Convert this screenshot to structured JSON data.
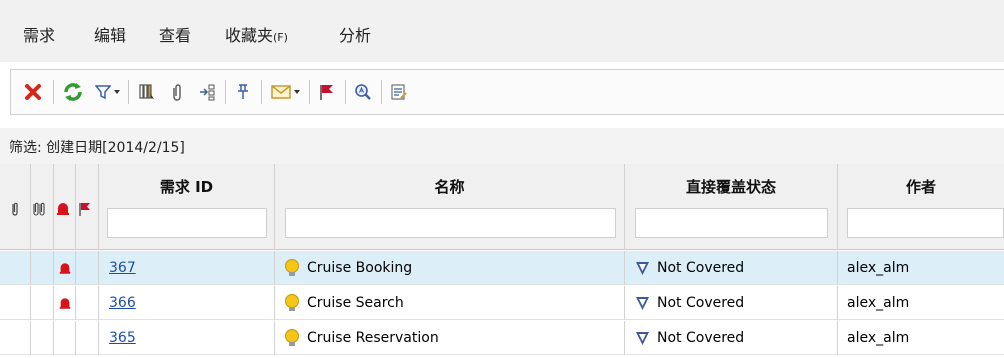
{
  "menu": {
    "items": [
      {
        "label": "需求",
        "hotkey": ""
      },
      {
        "label": "编辑",
        "hotkey": ""
      },
      {
        "label": "查看",
        "hotkey": ""
      },
      {
        "label": "收藏夹",
        "hotkey": "(F)"
      },
      {
        "label": "分析",
        "hotkey": ""
      }
    ]
  },
  "toolbar": {
    "buttons": [
      {
        "icon": "delete-icon",
        "color": "#d9261c"
      },
      {
        "icon": "refresh-icon",
        "color": "#2e9c2e"
      },
      {
        "icon": "filter-icon",
        "color": "#3b5fa8"
      },
      {
        "icon": "select-columns-icon",
        "color": "#5a5a5a"
      },
      {
        "icon": "attachment-icon",
        "color": "#5a5a5a"
      },
      {
        "icon": "convert-tree-icon",
        "color": "#5a5a5a"
      },
      {
        "icon": "pin-icon",
        "color": "#3b5fa8"
      },
      {
        "icon": "email-icon",
        "color": "#c89a2a"
      },
      {
        "icon": "flag-icon",
        "color": "#c8102e"
      },
      {
        "icon": "search-icon",
        "color": "#3b5fa8"
      },
      {
        "icon": "report-icon",
        "color": "#3b5fa8"
      }
    ]
  },
  "filter": {
    "text": "筛选: 创建日期[2014/2/15]"
  },
  "grid": {
    "columns": [
      {
        "key": "id",
        "title": "需求 ID"
      },
      {
        "key": "name",
        "title": "名称"
      },
      {
        "key": "coverage",
        "title": "直接覆盖状态"
      },
      {
        "key": "author",
        "title": "作者"
      }
    ],
    "rows": [
      {
        "id": "367",
        "name": "Cruise Booking",
        "coverage": "Not Covered",
        "author": "alex_alm",
        "alert": true,
        "selected": true
      },
      {
        "id": "366",
        "name": "Cruise Search",
        "coverage": "Not Covered",
        "author": "alex_alm",
        "alert": true,
        "selected": false
      },
      {
        "id": "365",
        "name": "Cruise Reservation",
        "coverage": "Not Covered",
        "author": "alex_alm",
        "alert": false,
        "selected": false
      }
    ]
  },
  "colors": {
    "alert_bell": "#d8121b",
    "flag": "#c8102e",
    "bulb": "#f5c518",
    "coverage_icon": "#3d5a96",
    "link": "#1a4fa8",
    "selected_row": "#dceff9"
  }
}
